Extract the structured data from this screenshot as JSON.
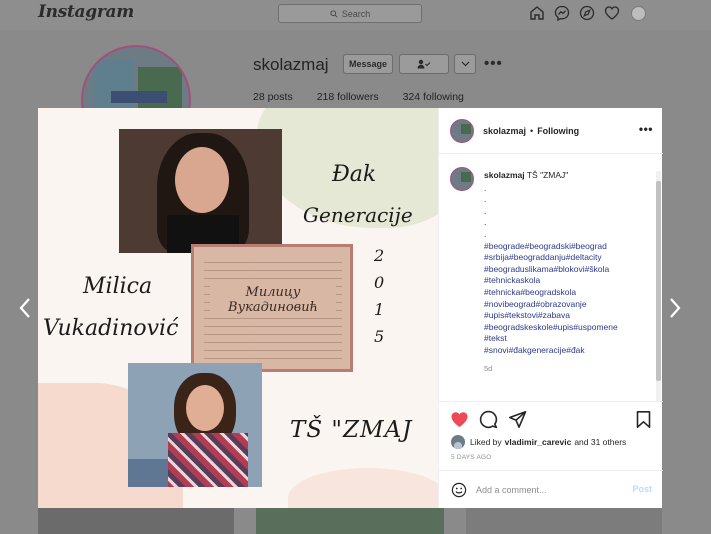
{
  "nav": {
    "logo": "Instagram",
    "search_placeholder": "Search"
  },
  "profile": {
    "username": "skolazmaj",
    "message_label": "Message",
    "stats": {
      "posts": "28 posts",
      "followers": "218 followers",
      "following": "324 following"
    },
    "more": "•••"
  },
  "post": {
    "image_text": {
      "dak": "Đak",
      "generacije": "Generacije",
      "milica": "Milica",
      "vukadinovic": "Vukadinović",
      "year_digits": [
        "2",
        "0",
        "1",
        "5"
      ],
      "school": "TŠ \"ZMAJ",
      "diploma_name": "Милицу Вукадиновић"
    },
    "header": {
      "username": "skolazmaj",
      "separator": "•",
      "following": "Following",
      "more": "•••"
    },
    "caption": {
      "username": "skolazmaj",
      "text": "TŠ \"ZMAJ\"",
      "dots": [
        ".",
        ".",
        ".",
        ".",
        "."
      ],
      "hashtags": [
        "#beograde#beogradski#beograd",
        "#srbija#beograddanju#deltacity",
        "#beograduslikama#blokovi#škola",
        "#tehnickaskola",
        "#tehnicka#beogradskola",
        "#novibeograd#obrazovanje",
        "#upis#tekstovi#zabava",
        "#beogradskeskole#upis#uspomene",
        "#tekst",
        "#snovi#đakgeneracije#đak"
      ],
      "time": "5d"
    },
    "likes": {
      "prefix": "Liked by",
      "user": "vladimir_carevic",
      "suffix": "and 31 others"
    },
    "date": "5 DAYS AGO",
    "comment": {
      "placeholder": "Add a comment...",
      "post_label": "Post"
    }
  },
  "colors": {
    "heart": "#ed4956",
    "hashtag": "#2b3a8f",
    "post_button": "#b2dffc",
    "overlay": "#8a8a8a"
  }
}
